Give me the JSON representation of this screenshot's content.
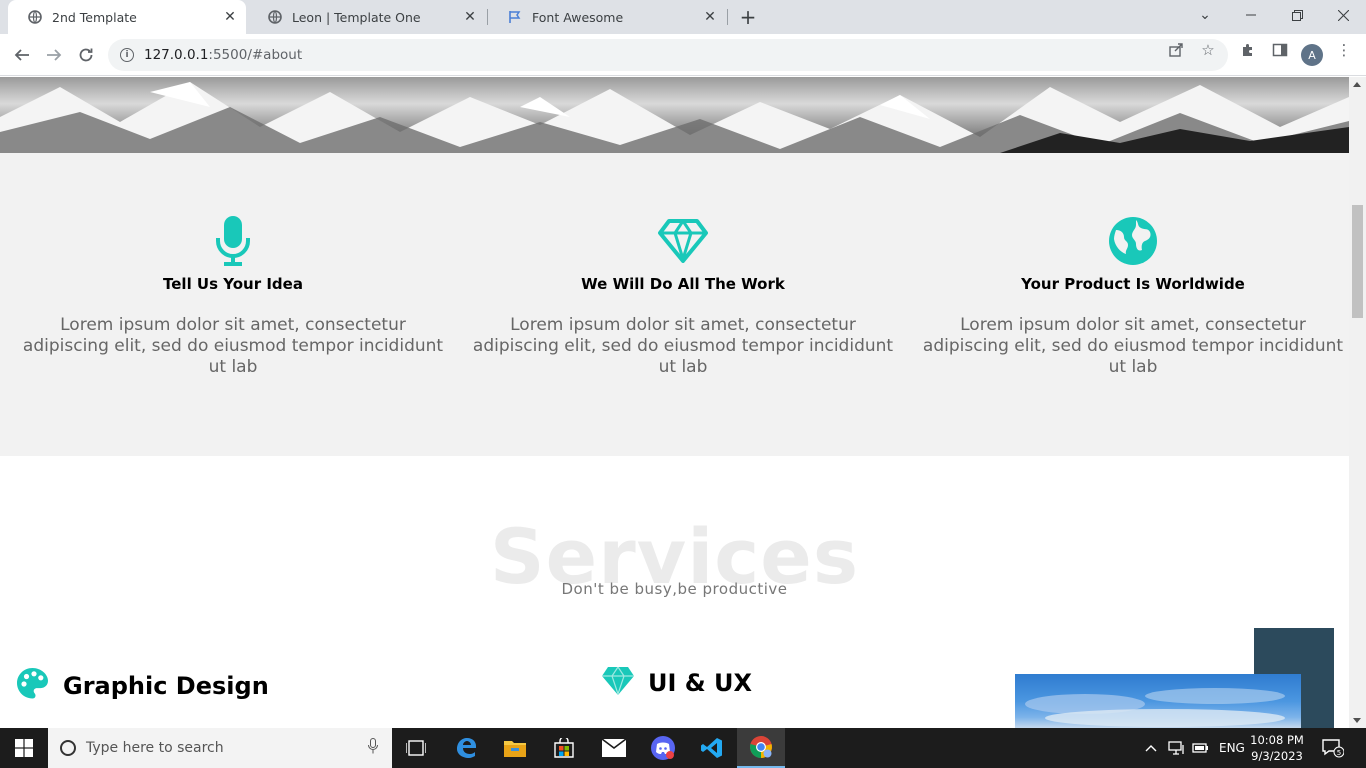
{
  "browser": {
    "tabs": [
      {
        "title": "2nd Template",
        "active": true
      },
      {
        "title": "Leon | Template One",
        "active": false
      },
      {
        "title": "Font Awesome",
        "active": false
      }
    ],
    "url_host": "127.0.0.1",
    "url_rest": ":5500/#about",
    "profile_initial": "A"
  },
  "features": [
    {
      "icon": "microphone-icon",
      "title": "Tell Us Your Idea",
      "text": "Lorem ipsum dolor sit amet, consectetur adipiscing elit, sed do eiusmod tempor incididunt ut lab"
    },
    {
      "icon": "gem-icon",
      "title": "We Will Do All The Work",
      "text": "Lorem ipsum dolor sit amet, consectetur adipiscing elit, sed do eiusmod tempor incididunt ut lab"
    },
    {
      "icon": "globe-icon",
      "title": "Your Product Is Worldwide",
      "text": "Lorem ipsum dolor sit amet, consectetur adipiscing elit, sed do eiusmod tempor incididunt ut lab"
    }
  ],
  "services": {
    "heading": "Services",
    "subheading": "Don't be busy,be productive",
    "items": [
      {
        "icon": "palette-icon",
        "title": "Graphic Design"
      },
      {
        "icon": "gem-icon",
        "title": "UI & UX"
      }
    ]
  },
  "colors": {
    "accent": "#19c8b9",
    "feature_bg": "#f2f2f2",
    "side_panel": "#2c4a5c"
  },
  "taskbar": {
    "search_placeholder": "Type here to search",
    "language": "ENG",
    "time": "10:08 PM",
    "date": "9/3/2023",
    "notification_count": "5"
  }
}
